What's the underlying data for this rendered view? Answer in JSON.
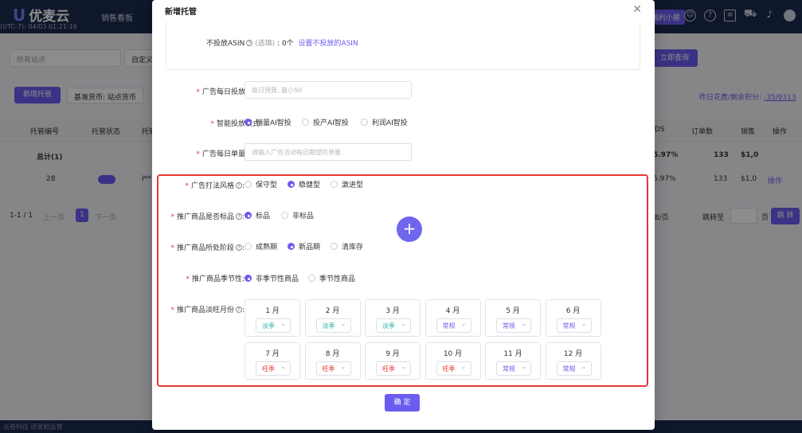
{
  "app": {
    "logo": "优麦云",
    "timezone": "(UTC-7): 04/03 01:21:16",
    "nav": [
      "销售看板"
    ],
    "badge": "福利小屋",
    "filters": {
      "site": "所有站点",
      "custom": "自定义"
    },
    "query_button": "立即查询",
    "toolbar": {
      "new_button": "新增托管",
      "currency": "基准货币: 站点货币"
    },
    "points": {
      "label": "昨日花费/剩余积分:",
      "value": "-35/9313"
    },
    "columns": [
      "托管编号",
      "托管状态",
      "托管",
      "DS",
      "订单数",
      "销售",
      "操作"
    ],
    "total": {
      "label": "总计(1)",
      "ds": "5.97%",
      "orders": "133",
      "sales": "$1,0"
    },
    "row": {
      "id": "28",
      "name": "I**",
      "ds": "5.97%",
      "orders": "133",
      "sales": "$1,0",
      "action": "操作"
    },
    "pagination": {
      "range": "1-1 / 1",
      "prev": "上一页",
      "page": "1",
      "next": "下一页",
      "per_page": "8/页",
      "goto": "跳转至",
      "page_unit": "页",
      "jump": "跳 转"
    },
    "footer": "云卷科技 研发和运营"
  },
  "modal": {
    "title": "新增托管",
    "exclude_asin": {
      "label": "不投放ASIN",
      "optional": "(选填)",
      "count": "0个",
      "link": "设置不投放的ASIN"
    },
    "budget": {
      "label": "广告每日投放预算:",
      "placeholder": "每日预算, 最小50"
    },
    "mode": {
      "label": "智能投放模式:",
      "options": [
        "销量AI智投",
        "投产AI智投",
        "利润AI智投"
      ],
      "selected": 0
    },
    "target": {
      "label": "广告每日单量目标:",
      "placeholder": "请输入广告活动每日期望的单量"
    },
    "style": {
      "label": "广告打法风格",
      "options": [
        "保守型",
        "稳健型",
        "激进型"
      ],
      "selected": 1
    },
    "standard": {
      "label": "推广商品是否标品",
      "options": [
        "标品",
        "非标品"
      ],
      "selected": 0
    },
    "stage": {
      "label": "推广商品所处阶段",
      "options": [
        "成熟期",
        "新品期",
        "清库存"
      ],
      "selected": 1
    },
    "season": {
      "label": "推广商品季节性",
      "options": [
        "非季节性商品",
        "季节性商品"
      ],
      "selected": 0
    },
    "months_label": "推广商品淡旺月份",
    "months": [
      {
        "label": "1 月",
        "value": "淡季"
      },
      {
        "label": "2 月",
        "value": "淡季"
      },
      {
        "label": "3 月",
        "value": "淡季"
      },
      {
        "label": "4 月",
        "value": "常规"
      },
      {
        "label": "5 月",
        "value": "常规"
      },
      {
        "label": "6 月",
        "value": "常规"
      },
      {
        "label": "7 月",
        "value": "旺季"
      },
      {
        "label": "8 月",
        "value": "旺季"
      },
      {
        "label": "9 月",
        "value": "旺季"
      },
      {
        "label": "10 月",
        "value": "旺季"
      },
      {
        "label": "11 月",
        "value": "常规"
      },
      {
        "label": "12 月",
        "value": "常规"
      }
    ],
    "season_colors": {
      "淡季": "#26b3a6",
      "常规": "#6b5cf0",
      "旺季": "#e53935"
    },
    "add_icon": "plus-icon",
    "confirm": "确 定"
  },
  "colors": {
    "primary": "#6b5cf0",
    "highlight": "#e53935",
    "topbar": "#1d2b4f"
  }
}
